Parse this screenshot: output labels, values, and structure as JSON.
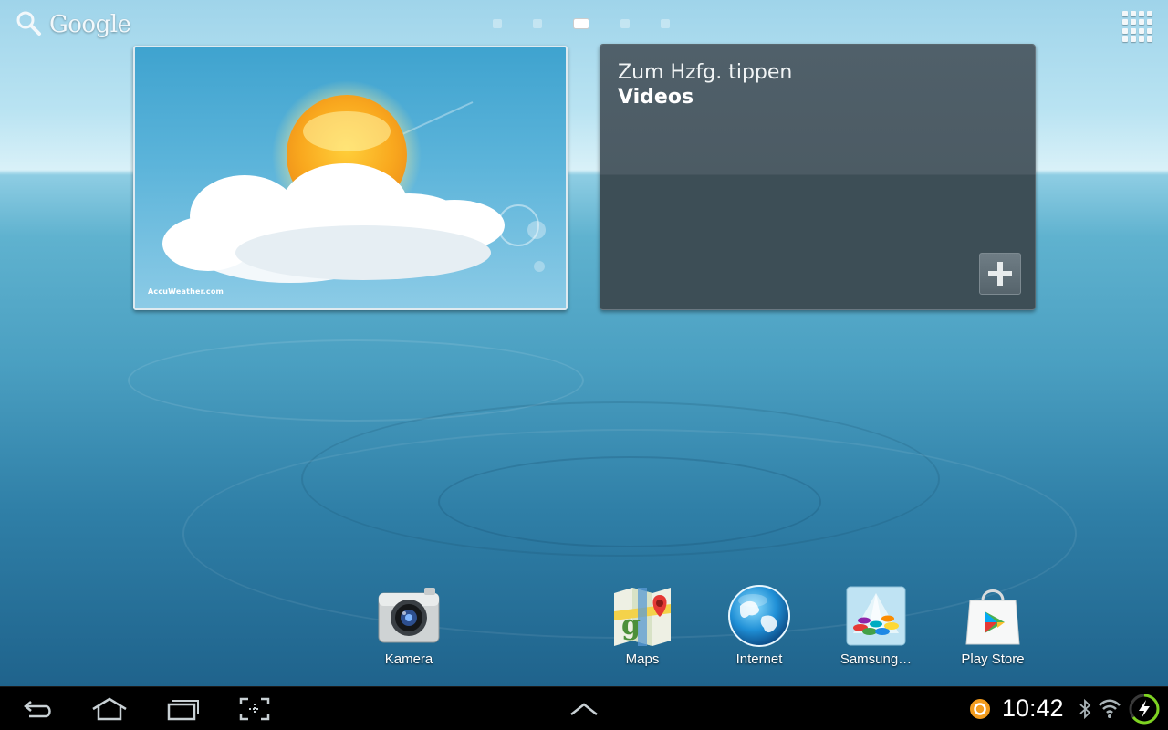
{
  "top_bar": {
    "google_label": "Google",
    "page_dots": [
      {
        "active": false
      },
      {
        "active": false
      },
      {
        "active": true
      },
      {
        "active": false
      },
      {
        "active": false
      }
    ]
  },
  "weather_widget": {
    "brand": "AccuWeather.com"
  },
  "video_widget": {
    "hint": "Zum Hzfg. tippen",
    "title": "Videos"
  },
  "dock": {
    "apps": [
      {
        "label": "Kamera",
        "icon": "camera-icon"
      },
      {
        "label": "Maps",
        "icon": "maps-icon"
      },
      {
        "label": "Internet",
        "icon": "globe-icon"
      },
      {
        "label": "Samsung…",
        "icon": "samsung-apps-icon"
      },
      {
        "label": "Play Store",
        "icon": "play-store-icon"
      }
    ]
  },
  "status_bar": {
    "time": "10:42"
  },
  "colors": {
    "nav_bar": "#000000",
    "video_widget_bg": "#3d4e56",
    "wallpaper_accent": "#3a8fb3"
  }
}
